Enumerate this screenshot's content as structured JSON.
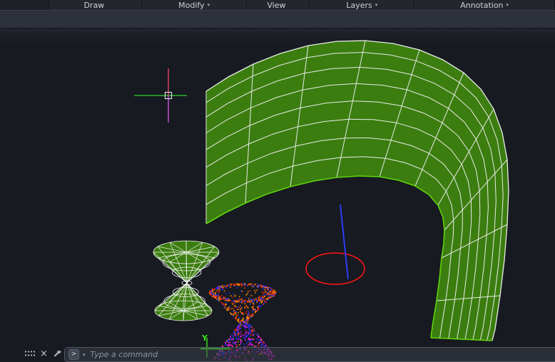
{
  "menubar": {
    "tabs": [
      {
        "label": "Draw",
        "caret": ""
      },
      {
        "label": "Modify",
        "caret": "▾"
      },
      {
        "label": "View",
        "caret": ""
      },
      {
        "label": "Layers",
        "caret": "▾"
      },
      {
        "label": "Annotation",
        "caret": "▾"
      }
    ]
  },
  "viewport": {
    "ucs_label": "Y"
  },
  "command_bar": {
    "prompt_symbol": ">",
    "caret": "▾",
    "placeholder": "Type a command"
  },
  "statusbar_icons": {
    "grip": "drag-grip-dots",
    "close_glyph": "×",
    "customize": "wrench"
  },
  "scene_objects": [
    "curved-surface-mesh",
    "hourglass-wireframe-mesh",
    "point-cloud-hourglass",
    "red-ellipse",
    "blue-vertical-line",
    "crosshair-cursor",
    "ucs-y-axis"
  ],
  "colors": {
    "surface_green": "#3C7D0F",
    "mesh_line": "#E8ECE8",
    "edge_lime": "#5FD40E",
    "ellipse_red": "#FF1515",
    "line_blue": "#2A3EF2",
    "crosshair_h": "#2ED52E",
    "crosshair_v_top": "#EE4B6A",
    "crosshair_v_bottom": "#DA55E8",
    "pickbox": "#D8DCE0",
    "ucs_green": "#3BDD1C",
    "cloud_red": "#FF2800",
    "cloud_orange": "#FF8A00",
    "cloud_blue": "#2430FF",
    "cloud_magenta": "#FF14E0"
  }
}
